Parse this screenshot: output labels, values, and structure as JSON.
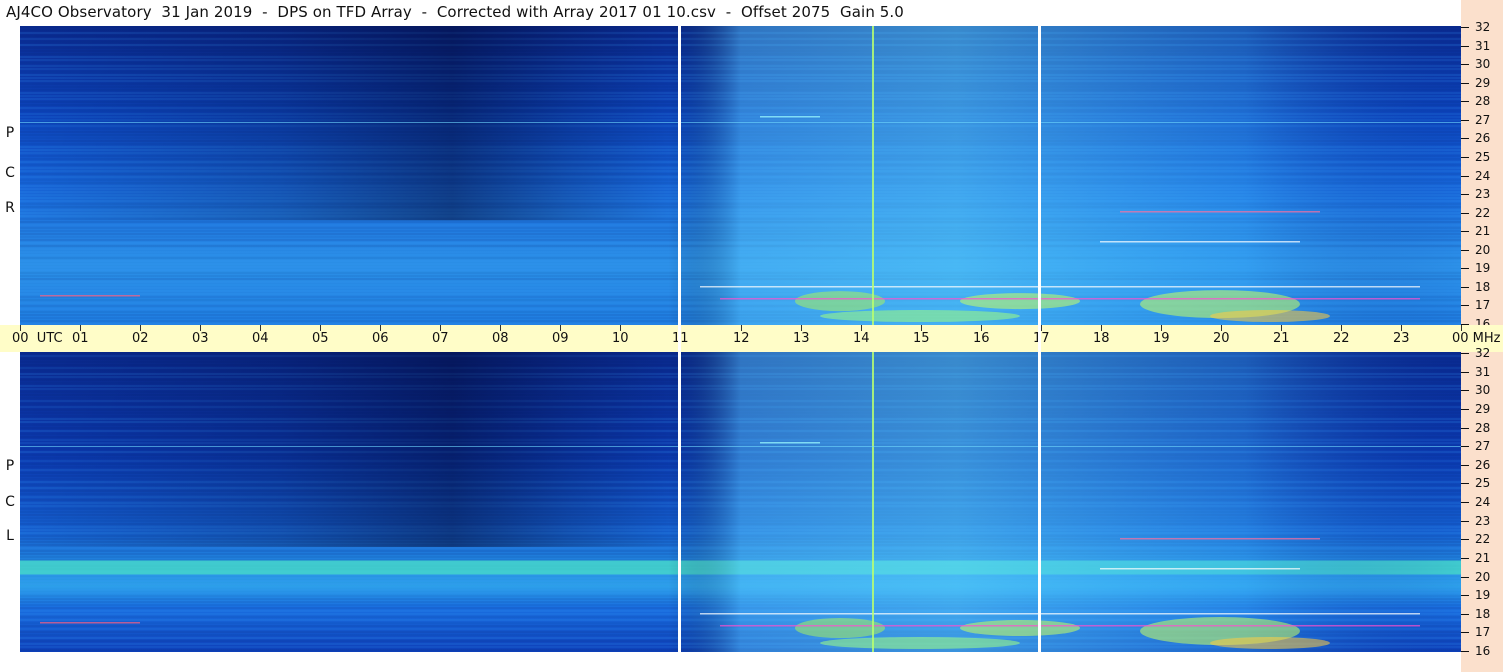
{
  "title": "AJ4CO Observatory  31 Jan 2019  -  DPS on TFD Array  -  Corrected with Array 2017 01 10.csv  -  Offset 2075  Gain 5.0",
  "panels": {
    "top": {
      "label": [
        "R",
        "C",
        "P"
      ]
    },
    "bottom": {
      "label": [
        "L",
        "C",
        "P"
      ]
    }
  },
  "mhz_axis": {
    "ticks": [
      "32",
      "31",
      "30",
      "29",
      "28",
      "27",
      "26",
      "25",
      "24",
      "23",
      "22",
      "21",
      "20",
      "19",
      "18",
      "17",
      "16"
    ]
  },
  "time_axis": {
    "labels": [
      "00",
      "01",
      "02",
      "03",
      "04",
      "05",
      "06",
      "07",
      "08",
      "09",
      "10",
      "11",
      "12",
      "13",
      "14",
      "15",
      "16",
      "17",
      "18",
      "19",
      "20",
      "21",
      "22",
      "23",
      "00"
    ],
    "utc_label": "UTC",
    "mhz_label": "MHz"
  },
  "colors": {
    "background_dark": "#0a2f9a",
    "background_mid": "#1a6fe0",
    "emission": "#7de0ff",
    "strong_emission": "#c8ff60",
    "right_strip": "#fbe0cc",
    "time_bar": "#fffdc8"
  }
}
